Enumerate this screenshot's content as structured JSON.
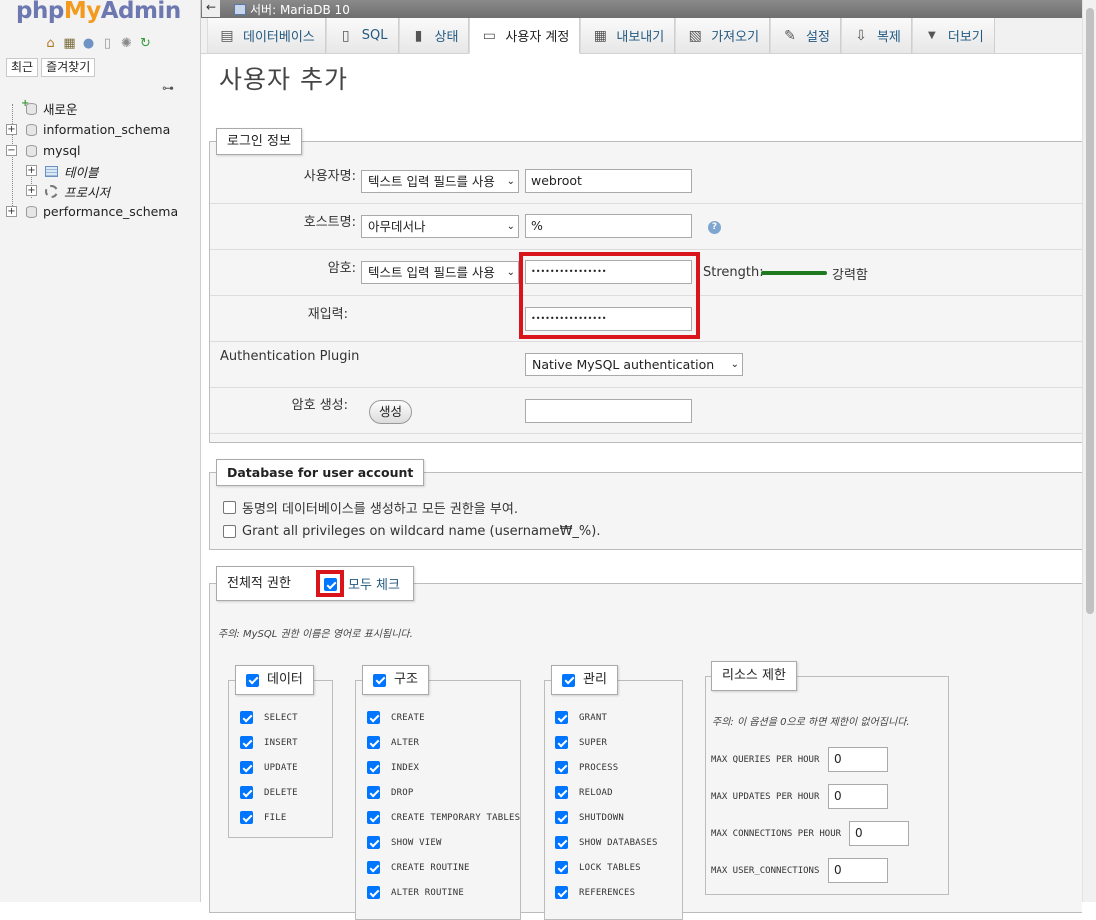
{
  "nav": {
    "logo": {
      "php": "php",
      "my": "My",
      "admin": "Admin"
    },
    "icons": [
      "home-icon",
      "exit-icon",
      "help-icon",
      "docs-icon",
      "settings-icon",
      "reload-icon"
    ],
    "tabs": [
      "최근",
      "즐겨찾기"
    ],
    "tree": {
      "new": "새로운",
      "db1": "information_schema",
      "db2": "mysql",
      "tables": "테이블",
      "procs": "프로시저",
      "db3": "performance_schema"
    }
  },
  "topbar": {
    "back": "←",
    "server": "서버: MariaDB 10"
  },
  "tabs": [
    {
      "label": "데이터베이스",
      "icon": "▤"
    },
    {
      "label": "SQL",
      "icon": "▯"
    },
    {
      "label": "상태",
      "icon": "▮"
    },
    {
      "label": "사용자 계정",
      "icon": "▭"
    },
    {
      "label": "내보내기",
      "icon": "▦"
    },
    {
      "label": "가져오기",
      "icon": "▧"
    },
    {
      "label": "설정",
      "icon": "✎"
    },
    {
      "label": "복제",
      "icon": "⇩"
    },
    {
      "label": "더보기",
      "icon": "▼"
    }
  ],
  "title": "사용자 추가",
  "login": {
    "legend": "로그인 정보",
    "user_label": "사용자명:",
    "user_select": "텍스트 입력 필드를 사용",
    "user_value": "webroot",
    "host_label": "호스트명:",
    "host_select": "아무데서나",
    "host_value": "%",
    "pw_label": "암호:",
    "pw_select": "텍스트 입력 필드를 사용",
    "pw_value": "••••••••••••••••",
    "strength_label": "Strength:",
    "strength_value": "강력함",
    "repw_label": "재입력:",
    "repw_value": "••••••••••••••••",
    "auth_label": "Authentication Plugin",
    "auth_value": "Native MySQL authentication",
    "gen_label": "암호 생성:",
    "gen_button": "생성",
    "gen_value": ""
  },
  "dbsection": {
    "legend": "Database for user account",
    "opt1": "동명의 데이터베이스를 생성하고 모든 권한을 부여.",
    "opt2": "Grant all privileges on wildcard name (username₩_%)."
  },
  "global": {
    "legend": "전체적 권한",
    "checkall": "모두 체크",
    "note": "주의: MySQL 권한 이름은 영어로 표시됩니다.",
    "data": {
      "title": "데이터",
      "items": [
        "SELECT",
        "INSERT",
        "UPDATE",
        "DELETE",
        "FILE"
      ]
    },
    "structure": {
      "title": "구조",
      "items": [
        "CREATE",
        "ALTER",
        "INDEX",
        "DROP",
        "CREATE TEMPORARY TABLES",
        "SHOW VIEW",
        "CREATE ROUTINE",
        "ALTER ROUTINE"
      ]
    },
    "admin": {
      "title": "관리",
      "items": [
        "GRANT",
        "SUPER",
        "PROCESS",
        "RELOAD",
        "SHUTDOWN",
        "SHOW DATABASES",
        "LOCK TABLES",
        "REFERENCES"
      ]
    },
    "limits": {
      "title": "리소스 제한",
      "note": "주의: 이 옵션을 0으로 하면 제한이 없어집니다.",
      "items": [
        {
          "label": "MAX QUERIES PER HOUR",
          "value": "0"
        },
        {
          "label": "MAX UPDATES PER HOUR",
          "value": "0"
        },
        {
          "label": "MAX CONNECTIONS PER HOUR",
          "value": "0"
        },
        {
          "label": "MAX USER_CONNECTIONS",
          "value": "0"
        }
      ]
    }
  },
  "colors": {
    "highlight": "#d9141b",
    "checkbox": "#0075ff",
    "strength": "#1f7a1f",
    "link": "#235a81"
  }
}
